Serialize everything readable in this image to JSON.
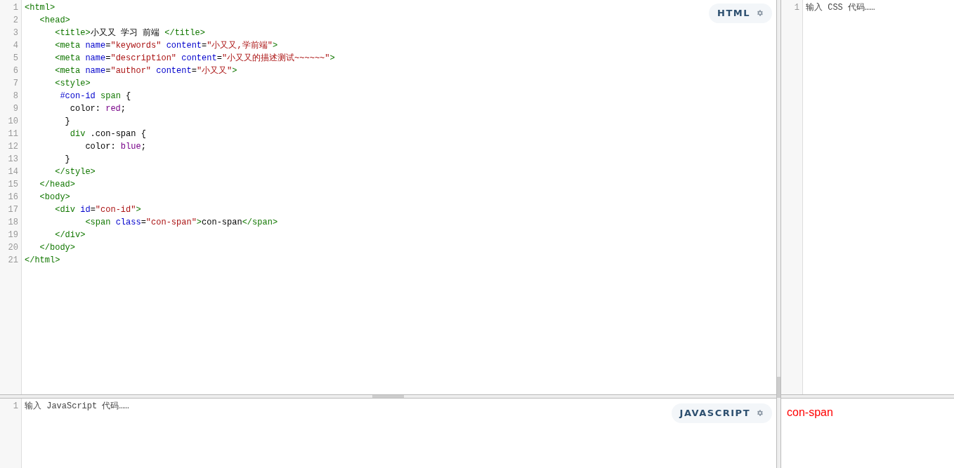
{
  "html_editor": {
    "label": "HTML",
    "lines": [
      {
        "number": "1",
        "tokens": [
          {
            "kind": "tag",
            "text": "<html>"
          }
        ]
      },
      {
        "number": "2",
        "tokens": [
          {
            "kind": "tag",
            "text": "   <head>"
          }
        ]
      },
      {
        "number": "3",
        "tokens": [
          {
            "kind": "tag",
            "text": "      <title>"
          },
          {
            "kind": "text",
            "text": "小又又 学习 前端 "
          },
          {
            "kind": "tag",
            "text": "</title>"
          }
        ]
      },
      {
        "number": "4",
        "tokens": [
          {
            "kind": "tag",
            "text": "      <meta "
          },
          {
            "kind": "attr",
            "text": "name"
          },
          {
            "kind": "text",
            "text": "="
          },
          {
            "kind": "string",
            "text": "\"keywords\" "
          },
          {
            "kind": "attr",
            "text": "content"
          },
          {
            "kind": "text",
            "text": "="
          },
          {
            "kind": "string",
            "text": "\"小又又,学前端\""
          },
          {
            "kind": "tag",
            "text": ">"
          }
        ]
      },
      {
        "number": "5",
        "tokens": [
          {
            "kind": "tag",
            "text": "      <meta "
          },
          {
            "kind": "attr",
            "text": "name"
          },
          {
            "kind": "text",
            "text": "="
          },
          {
            "kind": "string",
            "text": "\"description\" "
          },
          {
            "kind": "attr",
            "text": "content"
          },
          {
            "kind": "text",
            "text": "="
          },
          {
            "kind": "string",
            "text": "\"小又又的描述测试~~~~~~\""
          },
          {
            "kind": "tag",
            "text": ">"
          }
        ]
      },
      {
        "number": "6",
        "tokens": [
          {
            "kind": "tag",
            "text": "      <meta "
          },
          {
            "kind": "attr",
            "text": "name"
          },
          {
            "kind": "text",
            "text": "="
          },
          {
            "kind": "string",
            "text": "\"author\" "
          },
          {
            "kind": "attr",
            "text": "content"
          },
          {
            "kind": "text",
            "text": "="
          },
          {
            "kind": "string",
            "text": "\"小又又\""
          },
          {
            "kind": "tag",
            "text": ">"
          }
        ]
      },
      {
        "number": "7",
        "tokens": [
          {
            "kind": "tag",
            "text": "      <style>"
          }
        ]
      },
      {
        "number": "8",
        "tokens": [
          {
            "kind": "id",
            "text": "       #con-id "
          },
          {
            "kind": "tag",
            "text": "span"
          },
          {
            "kind": "text",
            "text": " {"
          }
        ]
      },
      {
        "number": "9",
        "tokens": [
          {
            "kind": "text",
            "text": "         color: "
          },
          {
            "kind": "atom",
            "text": "red"
          },
          {
            "kind": "text",
            "text": ";"
          }
        ]
      },
      {
        "number": "10",
        "tokens": [
          {
            "kind": "text",
            "text": "        }"
          }
        ]
      },
      {
        "number": "11",
        "tokens": [
          {
            "kind": "tag",
            "text": "         div"
          },
          {
            "kind": "text",
            "text": " .con-span {"
          }
        ]
      },
      {
        "number": "12",
        "tokens": [
          {
            "kind": "text",
            "text": "            color: "
          },
          {
            "kind": "atom",
            "text": "blue"
          },
          {
            "kind": "text",
            "text": ";"
          }
        ]
      },
      {
        "number": "13",
        "tokens": [
          {
            "kind": "text",
            "text": "        }"
          }
        ]
      },
      {
        "number": "14",
        "tokens": [
          {
            "kind": "tag",
            "text": "      </style>"
          }
        ]
      },
      {
        "number": "15",
        "tokens": [
          {
            "kind": "tag",
            "text": "   </head>"
          }
        ]
      },
      {
        "number": "16",
        "tokens": [
          {
            "kind": "tag",
            "text": "   <body>"
          }
        ]
      },
      {
        "number": "17",
        "tokens": [
          {
            "kind": "tag",
            "text": "      <div "
          },
          {
            "kind": "attr",
            "text": "id"
          },
          {
            "kind": "text",
            "text": "="
          },
          {
            "kind": "string",
            "text": "\"con-id\""
          },
          {
            "kind": "tag",
            "text": ">"
          }
        ]
      },
      {
        "number": "18",
        "tokens": [
          {
            "kind": "tag",
            "text": "            <span "
          },
          {
            "kind": "attr",
            "text": "class"
          },
          {
            "kind": "text",
            "text": "="
          },
          {
            "kind": "string",
            "text": "\"con-span\""
          },
          {
            "kind": "tag",
            "text": ">"
          },
          {
            "kind": "text",
            "text": "con-span"
          },
          {
            "kind": "tag",
            "text": "</span>"
          }
        ]
      },
      {
        "number": "19",
        "tokens": [
          {
            "kind": "tag",
            "text": "      </div>"
          }
        ]
      },
      {
        "number": "20",
        "tokens": [
          {
            "kind": "tag",
            "text": "   </body>"
          }
        ]
      },
      {
        "number": "21",
        "tokens": [
          {
            "kind": "tag",
            "text": "</html>"
          }
        ]
      }
    ]
  },
  "css_editor": {
    "line_number": "1",
    "placeholder": "输入 CSS 代码……"
  },
  "js_editor": {
    "label": "JAVASCRIPT",
    "line_number": "1",
    "placeholder": "输入 JavaScript 代码……"
  },
  "preview": {
    "text": "con-span"
  }
}
